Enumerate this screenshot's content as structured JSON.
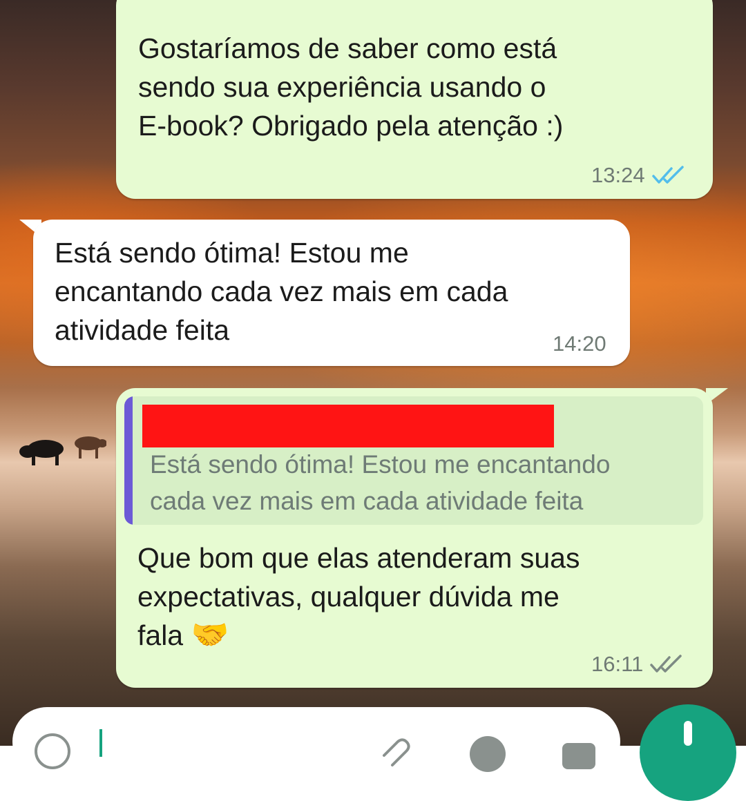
{
  "messages": [
    {
      "direction": "outgoing",
      "text": "Gostaríamos de saber como está\nsendo sua experiência usando o\nE-book? Obrigado pela atenção :)",
      "time": "13:24",
      "status": "read"
    },
    {
      "direction": "incoming",
      "text": "Está sendo ótima! Estou me\nencantando cada vez mais em cada\natividade feita",
      "time": "14:20"
    },
    {
      "direction": "outgoing",
      "quote": {
        "author_redacted": true,
        "text": "Está sendo ótima! Estou me encantando\ncada vez mais em cada atividade feita"
      },
      "text": "Que bom que elas atenderam suas\nexpectativas, qualquer dúvida me\nfala",
      "emoji": "🤝",
      "time": "16:11",
      "status": "delivered"
    }
  ],
  "icons": {
    "read_ticks": "double-check-icon",
    "delivered_ticks": "double-check-icon",
    "input_emoji": "emoji-icon",
    "input_attach": "paperclip-icon",
    "input_camera": "camera-icon",
    "send": "microphone-icon"
  },
  "colors": {
    "outgoing_bubble": "#e7fbd2",
    "incoming_bubble": "#ffffff",
    "read_tick": "#53bdeb",
    "delivered_tick": "#7d8a84",
    "quote_bar": "#6c5ad6",
    "redaction": "#ff1414",
    "send_button": "#16a37f"
  }
}
